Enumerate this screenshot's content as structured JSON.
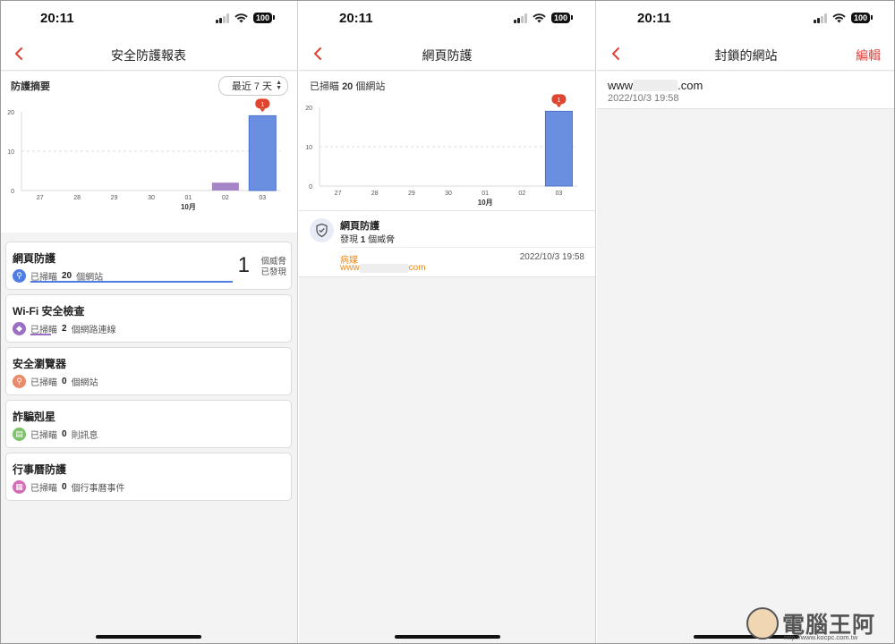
{
  "status_bar": {
    "time": "20:11",
    "battery": "100"
  },
  "screen1": {
    "title": "安全防護報表",
    "summary_label": "防護摘要",
    "range_button": "最近 7 天",
    "cards": [
      {
        "title": "網頁防護",
        "prefix": "已掃瞄",
        "count": "20",
        "suffix": "個網站",
        "threat_count": "1",
        "threat_label_1": "個威脅",
        "threat_label_2": "已發現",
        "icon": "search-icon",
        "color": "#4f7de0",
        "progress": 1.0
      },
      {
        "title": "Wi-Fi 安全檢查",
        "prefix": "已掃瞄",
        "count": "2",
        "suffix": "個網路連線",
        "icon": "wifi-icon",
        "color": "#9b6fc4",
        "progress": 0.1
      },
      {
        "title": "安全瀏覽器",
        "prefix": "已掃瞄",
        "count": "0",
        "suffix": "個網站",
        "icon": "search-icon",
        "color": "#e98a6a"
      },
      {
        "title": "詐騙剋星",
        "prefix": "已掃瞄",
        "count": "0",
        "suffix": "則訊息",
        "icon": "message-icon",
        "color": "#7cc26a"
      },
      {
        "title": "行事曆防護",
        "prefix": "已掃瞄",
        "count": "0",
        "suffix": "個行事曆事件",
        "icon": "calendar-icon",
        "color": "#d46fb6"
      }
    ]
  },
  "screen2": {
    "title": "網頁防護",
    "scanned_prefix": "已掃瞄",
    "scanned_count": "20",
    "scanned_suffix": "個網站",
    "section_title": "網頁防護",
    "found_prefix": "發現",
    "found_count": "1",
    "found_suffix": "個威脅",
    "threat_type": "病媒",
    "threat_url_prefix": "www",
    "threat_url_suffix": "com",
    "threat_time": "2022/10/3 19:58"
  },
  "screen3": {
    "title": "封鎖的網站",
    "edit_label": "編輯",
    "url_prefix": "www",
    "url_suffix": ".com",
    "time": "2022/10/3 19:58"
  },
  "chart_data": [
    {
      "type": "bar",
      "categories": [
        "27",
        "28",
        "29",
        "30",
        "01",
        "02",
        "03"
      ],
      "series": [
        {
          "values": [
            0,
            0,
            0,
            0,
            0,
            2,
            19
          ]
        }
      ],
      "bar_colors": [
        "#6a8fe0",
        "#6a8fe0",
        "#6a8fe0",
        "#6a8fe0",
        "#6a8fe0",
        "#a584c8",
        "#6a8fe0"
      ],
      "yticks": [
        "0",
        "10",
        "20"
      ],
      "ylim": [
        0,
        20
      ],
      "xgroup_label": "10月",
      "annotation": "1",
      "annotation_index": 6,
      "grid": true
    },
    {
      "type": "bar",
      "categories": [
        "27",
        "28",
        "29",
        "30",
        "01",
        "02",
        "03"
      ],
      "series": [
        {
          "values": [
            0,
            0,
            0,
            0,
            0,
            0,
            19
          ]
        }
      ],
      "bar_colors": [
        "#6a8fe0",
        "#6a8fe0",
        "#6a8fe0",
        "#6a8fe0",
        "#6a8fe0",
        "#6a8fe0",
        "#6a8fe0"
      ],
      "yticks": [
        "0",
        "10",
        "20"
      ],
      "ylim": [
        0,
        20
      ],
      "xgroup_label": "10月",
      "annotation": "1",
      "annotation_index": 6,
      "grid": true
    }
  ],
  "watermark": {
    "text": "電腦王阿達",
    "url": "http://www.kocpc.com.tw"
  }
}
